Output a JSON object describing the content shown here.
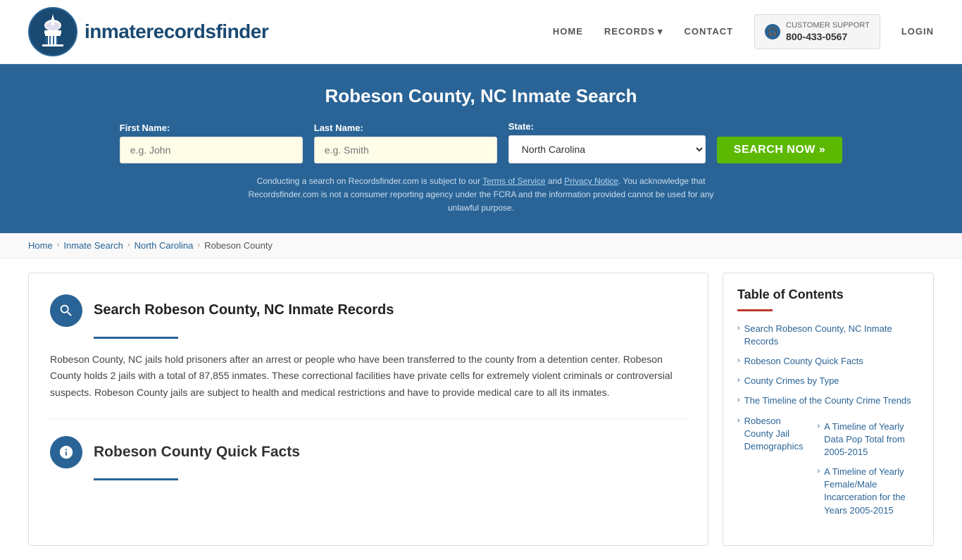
{
  "header": {
    "logo_text_regular": "inmaterecords",
    "logo_text_bold": "finder",
    "nav": {
      "home": "HOME",
      "records": "RECORDS",
      "contact": "CONTACT",
      "support_label": "CUSTOMER SUPPORT",
      "support_phone": "800-433-0567",
      "login": "LOGIN"
    }
  },
  "search_banner": {
    "title": "Robeson County, NC Inmate Search",
    "first_name_label": "First Name:",
    "first_name_placeholder": "e.g. John",
    "last_name_label": "Last Name:",
    "last_name_placeholder": "e.g. Smith",
    "state_label": "State:",
    "state_value": "North Carolina",
    "search_button": "SEARCH NOW »",
    "disclaimer": "Conducting a search on Recordsfinder.com is subject to our Terms of Service and Privacy Notice. You acknowledge that Recordsfinder.com is not a consumer reporting agency under the FCRA and the information provided cannot be used for any unlawful purpose.",
    "disclaimer_tos": "Terms of Service",
    "disclaimer_privacy": "Privacy Notice"
  },
  "breadcrumb": {
    "home": "Home",
    "inmate_search": "Inmate Search",
    "north_carolina": "North Carolina",
    "current": "Robeson County"
  },
  "main": {
    "section1": {
      "heading": "Search Robeson County, NC Inmate Records",
      "body": "Robeson County, NC jails hold prisoners after an arrest or people who have been transferred to the county from a detention center. Robeson County holds 2 jails with a total of 87,855 inmates. These correctional facilities have private cells for extremely violent criminals or controversial suspects. Robeson County jails are subject to health and medical restrictions and have to provide medical care to all its inmates."
    },
    "section2": {
      "heading": "Robeson County Quick Facts"
    }
  },
  "toc": {
    "title": "Table of Contents",
    "items": [
      {
        "label": "Search Robeson County, NC Inmate Records",
        "sub": []
      },
      {
        "label": "Robeson County Quick Facts",
        "sub": []
      },
      {
        "label": "County Crimes by Type",
        "sub": []
      },
      {
        "label": "The Timeline of the County Crime Trends",
        "sub": []
      },
      {
        "label": "Robeson County Jail Demographics",
        "sub": []
      },
      {
        "label": "A Timeline of Yearly Data Pop Total from 2005-2015",
        "sub": []
      },
      {
        "label": "A Timeline of Yearly Female/Male Incarceration for the Years 2005-2015",
        "sub": []
      }
    ]
  }
}
